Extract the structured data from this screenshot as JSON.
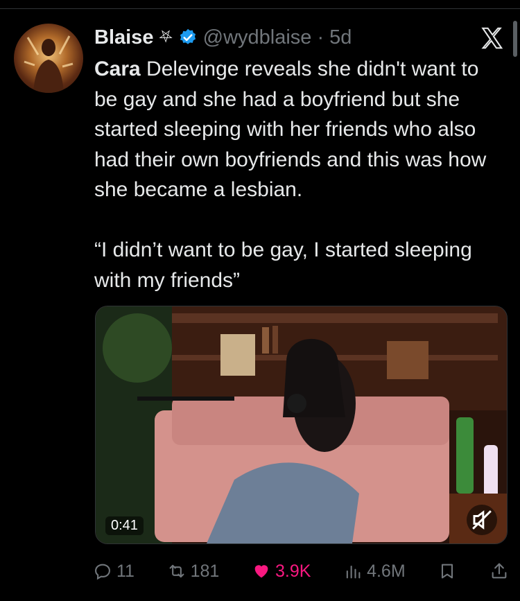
{
  "tweet": {
    "display_name": "Blaise",
    "name_symbol": "⛧",
    "handle": "@wydblaise",
    "separator": "·",
    "time": "5d",
    "text_lead": "Cara",
    "text_body": " Delevinge reveals she didn't want to be gay and she had a boyfriend but she started sleeping with her friends who also had their own boyfriends and this was how she became a lesbian.\n\n“I didn’t want to be gay, I started sleeping with my friends”"
  },
  "media": {
    "duration": "0:41",
    "mute_icon": "speaker-muted-icon"
  },
  "actions": {
    "replies": "11",
    "reposts": "181",
    "likes": "3.9K",
    "views": "4.6M"
  },
  "colors": {
    "background": "#000000",
    "text": "#e7e9ea",
    "muted": "#71767b",
    "verified": "#1d9bf0",
    "like": "#f91880"
  }
}
